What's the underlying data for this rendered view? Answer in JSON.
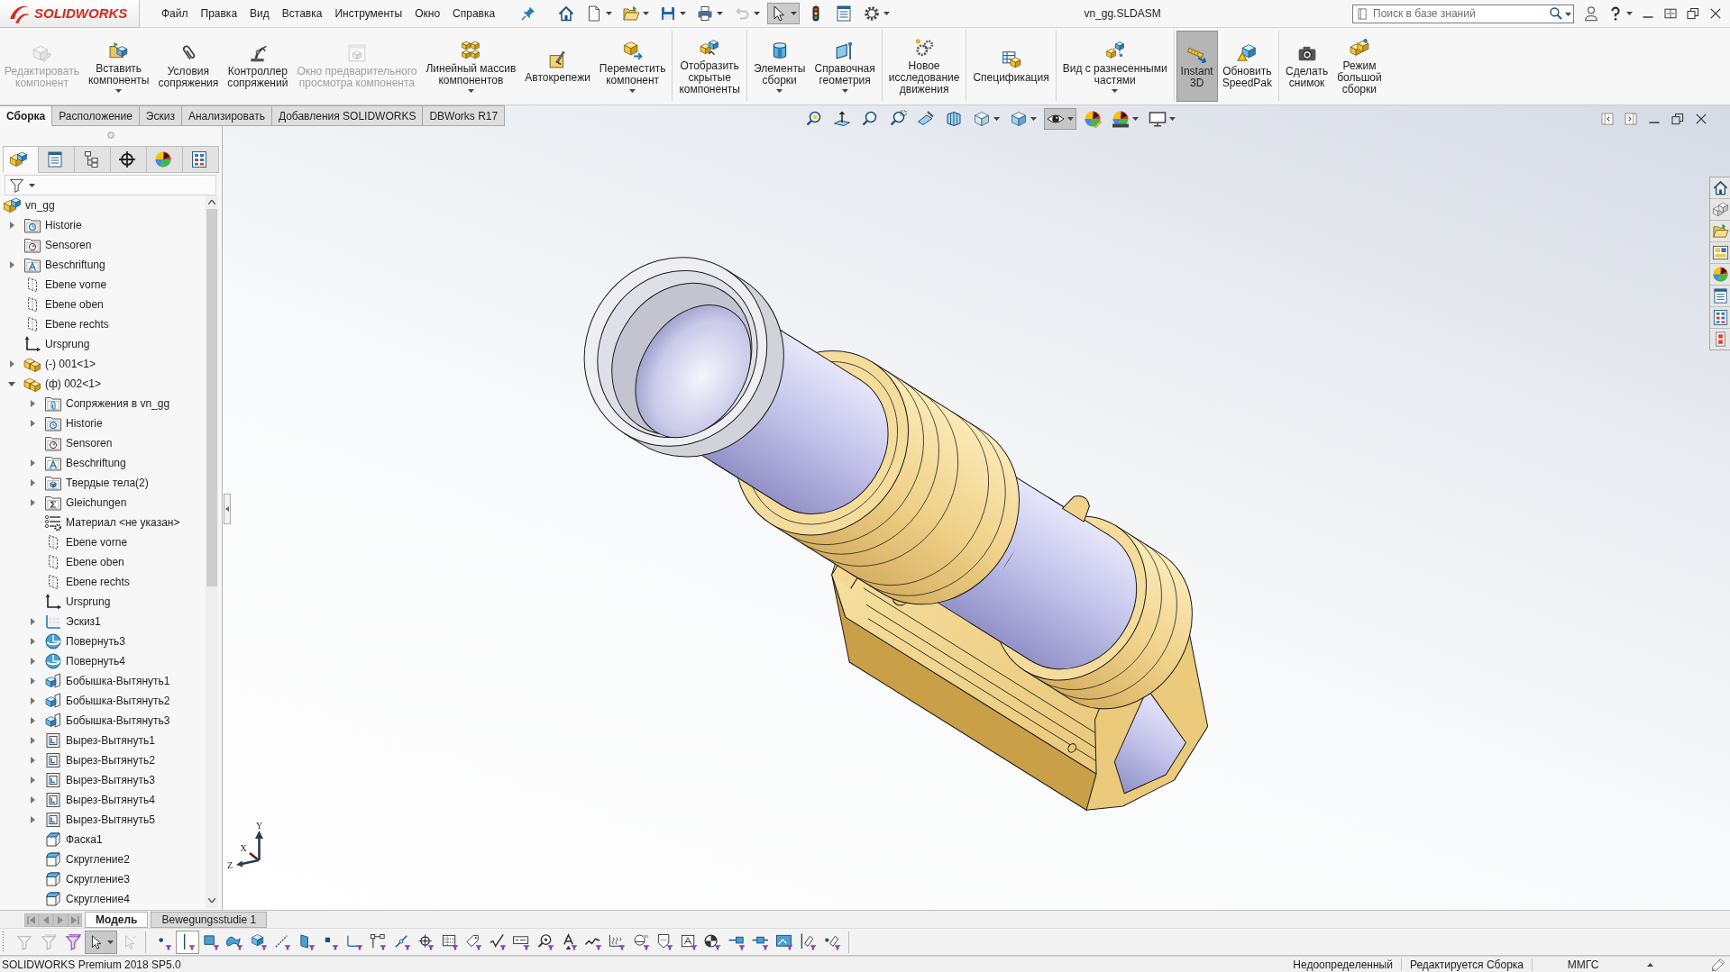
{
  "title_bar": {
    "logo": "SOLIDWORKS",
    "menu": [
      "Файл",
      "Правка",
      "Вид",
      "Вставка",
      "Инструменты",
      "Окно",
      "Справка"
    ],
    "quick_access": [
      {
        "kind": "home",
        "has_menu": false,
        "disabled": false,
        "on": false
      },
      {
        "kind": "new",
        "has_menu": true,
        "disabled": false,
        "on": false
      },
      {
        "kind": "open",
        "has_menu": true,
        "disabled": false,
        "on": false
      },
      {
        "kind": "save",
        "has_menu": true,
        "disabled": false,
        "on": false
      },
      {
        "kind": "print",
        "has_menu": true,
        "disabled": false,
        "on": false
      },
      {
        "kind": "undo",
        "has_menu": true,
        "disabled": true,
        "on": false
      },
      {
        "kind": "select",
        "has_menu": true,
        "disabled": false,
        "on": true
      },
      {
        "kind": "rebuild",
        "has_menu": false,
        "disabled": false,
        "on": false
      },
      {
        "kind": "properties",
        "has_menu": false,
        "disabled": false,
        "on": false
      },
      {
        "kind": "options",
        "has_menu": true,
        "disabled": false,
        "on": false
      }
    ],
    "document_title": "vn_gg.SLDASM",
    "search": {
      "placeholder": "Поиск в базе знаний"
    }
  },
  "ribbon": [
    [
      {
        "label": "Редактировать\nкомпонент",
        "kind": "edit",
        "disabled": true,
        "on": false,
        "has_menu": false
      },
      {
        "label": "Вставить\nкомпоненты",
        "kind": "insert",
        "disabled": false,
        "on": false,
        "has_menu": true
      },
      {
        "label": "Условия\nсопряжения",
        "kind": "mate",
        "disabled": false,
        "on": false,
        "has_menu": false
      },
      {
        "label": "Контроллер\nсопряжений",
        "kind": "mate-controller",
        "disabled": false,
        "on": false,
        "has_menu": false
      },
      {
        "label": "Окно предварительного\nпросмотра компонента",
        "kind": "preview",
        "disabled": true,
        "on": false,
        "has_menu": false
      },
      {
        "label": "Линейный массив\nкомпонентов",
        "kind": "pattern",
        "disabled": false,
        "on": false,
        "has_menu": true
      },
      {
        "label": "Автокрепежи",
        "kind": "fasteners",
        "disabled": false,
        "on": false,
        "has_menu": false
      },
      {
        "label": "Переместить\nкомпонент",
        "kind": "move",
        "disabled": false,
        "on": false,
        "has_menu": true
      }
    ],
    [
      {
        "label": "Отобразить\nскрытые\nкомпоненты",
        "kind": "show-hidden",
        "disabled": false,
        "on": false,
        "has_menu": false
      }
    ],
    [
      {
        "label": "Элементы\nсборки",
        "kind": "assembly-features",
        "disabled": false,
        "on": false,
        "has_menu": true
      },
      {
        "label": "Справочная\nгеометрия",
        "kind": "reference-geometry",
        "disabled": false,
        "on": false,
        "has_menu": true
      }
    ],
    [
      {
        "label": "Новое\nисследование\nдвижения",
        "kind": "motion-study",
        "disabled": false,
        "on": false,
        "has_menu": false
      }
    ],
    [
      {
        "label": "Спецификация",
        "kind": "bom",
        "disabled": false,
        "on": false,
        "has_menu": false
      }
    ],
    [
      {
        "label": "Вид с разнесенными\nчастями",
        "kind": "exploded-view",
        "disabled": false,
        "on": false,
        "has_menu": true
      }
    ],
    [
      {
        "label": "Instant\n3D",
        "kind": "instant3d",
        "disabled": false,
        "on": true,
        "has_menu": false
      },
      {
        "label": "Обновить\nSpeedPak",
        "kind": "speedpak",
        "disabled": false,
        "on": false,
        "has_menu": false
      }
    ],
    [
      {
        "label": "Сделать\nснимок",
        "kind": "snapshot",
        "disabled": false,
        "on": false,
        "has_menu": false
      },
      {
        "label": "Режим\nбольшой\nсборки",
        "kind": "large-assembly",
        "disabled": false,
        "on": false,
        "has_menu": false
      }
    ]
  ],
  "command_tabs": [
    {
      "label": "Сборка",
      "selected": true
    },
    {
      "label": "Расположение",
      "selected": false
    },
    {
      "label": "Эскиз",
      "selected": false
    },
    {
      "label": "Анализировать",
      "selected": false
    },
    {
      "label": "Добавления SOLIDWORKS",
      "selected": false
    },
    {
      "label": "DBWorks R17",
      "selected": false
    }
  ],
  "feature_manager": {
    "pane_tabs": [
      {
        "kind": "feature-tree",
        "selected": true
      },
      {
        "kind": "property",
        "selected": false
      },
      {
        "kind": "configuration",
        "selected": false
      },
      {
        "kind": "dimxpert",
        "selected": false
      },
      {
        "kind": "display",
        "selected": false
      },
      {
        "kind": "cam",
        "selected": false
      }
    ],
    "tree": [
      {
        "label": "vn_gg",
        "kind": "assembly",
        "children": [
          {
            "label": "Historie",
            "kind": "history",
            "expanded": false
          },
          {
            "label": "Sensoren",
            "kind": "sensors"
          },
          {
            "label": "Beschriftung",
            "kind": "annotations",
            "expanded": false
          },
          {
            "label": "Ebene vorne",
            "kind": "plane"
          },
          {
            "label": "Ebene oben",
            "kind": "plane"
          },
          {
            "label": "Ebene rechts",
            "kind": "plane"
          },
          {
            "label": "Ursprung",
            "kind": "origin"
          },
          {
            "label": "(-) 001<1>",
            "kind": "part",
            "expanded": false
          },
          {
            "label": "(ф) 002<1>",
            "kind": "part",
            "expanded": true,
            "children": [
              {
                "label": "Сопряжения в vn_gg",
                "kind": "mates",
                "expanded": false
              },
              {
                "label": "Historie",
                "kind": "history",
                "expanded": false
              },
              {
                "label": "Sensoren",
                "kind": "sensors"
              },
              {
                "label": "Beschriftung",
                "kind": "annotations",
                "expanded": false
              },
              {
                "label": "Твердые тела(2)",
                "kind": "bodies",
                "expanded": false
              },
              {
                "label": "Gleichungen",
                "kind": "equations",
                "expanded": false
              },
              {
                "label": "Материал <не указан>",
                "kind": "material"
              },
              {
                "label": "Ebene vorne",
                "kind": "plane"
              },
              {
                "label": "Ebene oben",
                "kind": "plane"
              },
              {
                "label": "Ebene rechts",
                "kind": "plane"
              },
              {
                "label": "Ursprung",
                "kind": "origin"
              },
              {
                "label": "Эскиз1",
                "kind": "sketch",
                "expanded": false
              },
              {
                "label": "Повернуть3",
                "kind": "revolve",
                "expanded": false
              },
              {
                "label": "Повернуть4",
                "kind": "revolve",
                "expanded": false
              },
              {
                "label": "Бобышка-Вытянуть1",
                "kind": "boss",
                "expanded": false
              },
              {
                "label": "Бобышка-Вытянуть2",
                "kind": "boss",
                "expanded": false
              },
              {
                "label": "Бобышка-Вытянуть3",
                "kind": "boss",
                "expanded": false
              },
              {
                "label": "Вырез-Вытянуть1",
                "kind": "cut",
                "expanded": false
              },
              {
                "label": "Вырез-Вытянуть2",
                "kind": "cut",
                "expanded": false
              },
              {
                "label": "Вырез-Вытянуть3",
                "kind": "cut",
                "expanded": false
              },
              {
                "label": "Вырез-Вытянуть4",
                "kind": "cut",
                "expanded": false
              },
              {
                "label": "Вырез-Вытянуть5",
                "kind": "cut",
                "expanded": false
              },
              {
                "label": "Фаска1",
                "kind": "chamfer"
              },
              {
                "label": "Скругление2",
                "kind": "fillet"
              },
              {
                "label": "Скругление3",
                "kind": "fillet"
              },
              {
                "label": "Скругление4",
                "kind": "fillet"
              }
            ]
          }
        ]
      }
    ]
  },
  "view_toolbar": [
    {
      "kind": "zoom-fit",
      "has_menu": false,
      "on": false
    },
    {
      "kind": "previous-view",
      "has_menu": false,
      "on": false
    },
    {
      "kind": "zoom-area",
      "has_menu": false,
      "on": false
    },
    {
      "kind": "zoom-selection",
      "has_menu": false,
      "on": false
    },
    {
      "kind": "section-view",
      "has_menu": false,
      "on": false
    },
    {
      "kind": "dynamic-annotation",
      "has_menu": false,
      "on": false
    },
    {
      "kind": "view-orientation",
      "has_menu": true,
      "on": false
    },
    {
      "kind": "display-style",
      "has_menu": true,
      "on": false
    },
    {
      "kind": "hide-show",
      "has_menu": true,
      "on": true
    },
    {
      "kind": "edit-appearance",
      "has_menu": false,
      "on": false
    },
    {
      "kind": "apply-scene",
      "has_menu": true,
      "on": false
    },
    {
      "kind": "view-settings",
      "has_menu": true,
      "on": false
    }
  ],
  "view_triad": [
    "Y",
    "X",
    "Z"
  ],
  "bottom_tabs": [
    {
      "label": "Модель",
      "selected": true
    },
    {
      "label": "Bewegungsstudie 1",
      "selected": false
    }
  ],
  "selection_toolbar": {
    "tools": [
      {
        "kind": "filter",
        "disabled": true,
        "on": false,
        "has_menu": false
      },
      {
        "kind": "filter-stack",
        "disabled": true,
        "on": false,
        "has_menu": false
      },
      {
        "kind": "filter-stack-color",
        "disabled": false,
        "on": false,
        "has_menu": false
      },
      {
        "kind": "select",
        "disabled": false,
        "on": true,
        "has_menu": true
      },
      {
        "kind": "select-other",
        "disabled": true,
        "on": false,
        "has_menu": false
      }
    ],
    "filters": [
      {
        "kind": "point",
        "on": false
      },
      {
        "kind": "axis",
        "on": true
      },
      {
        "kind": "face",
        "on": false
      },
      {
        "kind": "surface",
        "on": false
      },
      {
        "kind": "body",
        "on": false
      },
      {
        "kind": "edge",
        "on": false
      },
      {
        "kind": "plane",
        "on": false
      },
      {
        "kind": "vertex",
        "on": false
      },
      {
        "kind": "sketch",
        "on": false
      },
      {
        "kind": "corner",
        "on": false
      },
      {
        "kind": "segment",
        "on": false
      },
      {
        "kind": "center",
        "on": false
      },
      {
        "kind": "table",
        "on": false
      },
      {
        "kind": "tag",
        "on": false
      },
      {
        "kind": "check",
        "on": false
      },
      {
        "kind": "note",
        "on": false
      },
      {
        "kind": "lens",
        "on": false
      },
      {
        "kind": "text",
        "on": false
      },
      {
        "kind": "weld",
        "on": false
      },
      {
        "kind": "hatch",
        "on": false
      },
      {
        "kind": "balloon",
        "on": false
      },
      {
        "kind": "datum",
        "on": false
      },
      {
        "kind": "box-text",
        "on": false
      },
      {
        "kind": "pie",
        "on": false
      },
      {
        "kind": "conn-left",
        "on": false
      },
      {
        "kind": "conn",
        "on": false
      },
      {
        "kind": "picture",
        "on": false
      },
      {
        "kind": "pin-line",
        "on": false
      },
      {
        "kind": "dot-pin",
        "on": false
      }
    ]
  },
  "status_bar": {
    "product": "SOLIDWORKS Premium 2018 SP5.0",
    "fields": [
      "Недоопределенный",
      "Редактируется Сборка",
      "ММГС"
    ]
  }
}
